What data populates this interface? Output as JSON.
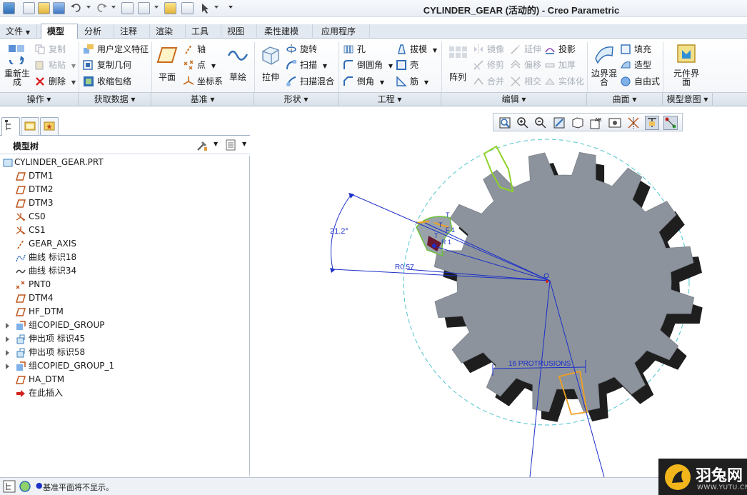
{
  "window": {
    "title": "CYLINDER_GEAR (活动的) - Creo Parametric"
  },
  "menu_tabs": [
    {
      "label": "文件",
      "has_dropdown": true
    },
    {
      "label": "模型",
      "active": true
    },
    {
      "label": "分析"
    },
    {
      "label": "注释"
    },
    {
      "label": "渲染"
    },
    {
      "label": "工具"
    },
    {
      "label": "视图"
    },
    {
      "label": "柔性建模"
    },
    {
      "label": "应用程序"
    }
  ],
  "ribbon": {
    "operations": {
      "regenerate": "重新生成",
      "copy": "复制",
      "paste": "粘贴",
      "delete": "删除",
      "group": "操作"
    },
    "get_data": {
      "udf": "用户定义特征",
      "copy_geom": "复制几何",
      "shrinkwrap": "收缩包络",
      "group": "获取数据"
    },
    "datum": {
      "plane": "平面",
      "axis": "轴",
      "point": "点",
      "csys": "坐标系",
      "sketch": "草绘",
      "group": "基准"
    },
    "shapes": {
      "extrude": "拉伸",
      "revolve": "旋转",
      "sweep": "扫描",
      "swept_blend": "扫描混合",
      "group": "形状"
    },
    "engineering": {
      "hole": "孔",
      "round": "倒圆角",
      "chamfer": "倒角",
      "draft": "拔模",
      "shell": "壳",
      "rib": "筋",
      "group": "工程"
    },
    "editing": {
      "pattern": "阵列",
      "mirror": "镜像",
      "trim": "修剪",
      "merge": "合并",
      "extend": "延伸",
      "offset": "偏移",
      "intersect": "相交",
      "project": "投影",
      "thicken": "加厚",
      "solidify": "实体化",
      "group": "编辑"
    },
    "surfaces": {
      "boundary_blend": "边界混合",
      "fill": "填充",
      "style": "造型",
      "freestyle": "自由式",
      "group": "曲面"
    },
    "model_intent": {
      "component_interface": "元件界面",
      "group": "模型意图"
    }
  },
  "model_tree": {
    "header": "模型树",
    "items": [
      {
        "label": "CYLINDER_GEAR.PRT",
        "icon": "part-icon"
      },
      {
        "label": "DTM1",
        "icon": "datum-plane-icon"
      },
      {
        "label": "DTM2",
        "icon": "datum-plane-icon"
      },
      {
        "label": "DTM3",
        "icon": "datum-plane-icon"
      },
      {
        "label": "CS0",
        "icon": "csys-icon"
      },
      {
        "label": "CS1",
        "icon": "csys-icon"
      },
      {
        "label": "GEAR_AXIS",
        "icon": "axis-icon"
      },
      {
        "label": "曲线 标识18",
        "icon": "curve-icon"
      },
      {
        "label": "曲线 标识34",
        "icon": "curve-icon"
      },
      {
        "label": "PNT0",
        "icon": "point-icon"
      },
      {
        "label": "DTM4",
        "icon": "datum-plane-icon"
      },
      {
        "label": "HF_DTM",
        "icon": "datum-plane-icon"
      },
      {
        "label": "组COPIED_GROUP",
        "icon": "group-icon",
        "expandable": true
      },
      {
        "label": "伸出项 标识45",
        "icon": "protrusion-icon",
        "expandable": true
      },
      {
        "label": "伸出项 标识58",
        "icon": "protrusion-icon",
        "expandable": true
      },
      {
        "label": "组COPIED_GROUP_1",
        "icon": "group-icon",
        "expandable": true
      },
      {
        "label": "HA_DTM",
        "icon": "datum-plane-icon"
      },
      {
        "label": "在此插入",
        "icon": "insert-here-arrow-icon"
      }
    ]
  },
  "graphics": {
    "dim_angle": "21.2°",
    "dim_radius": "R0.57",
    "dim_pattern": "16 PROTRUSIONS",
    "labels": {
      "t1": "T",
      "t2": "T",
      "f1": "F 1",
      "r1": "R 1",
      "t3": "T"
    },
    "gear_color": "#8c939c"
  },
  "status": {
    "message": "基准平面将不显示。"
  },
  "watermark": {
    "text": "羽兔网",
    "url": "WWW.YUTU.CN"
  }
}
